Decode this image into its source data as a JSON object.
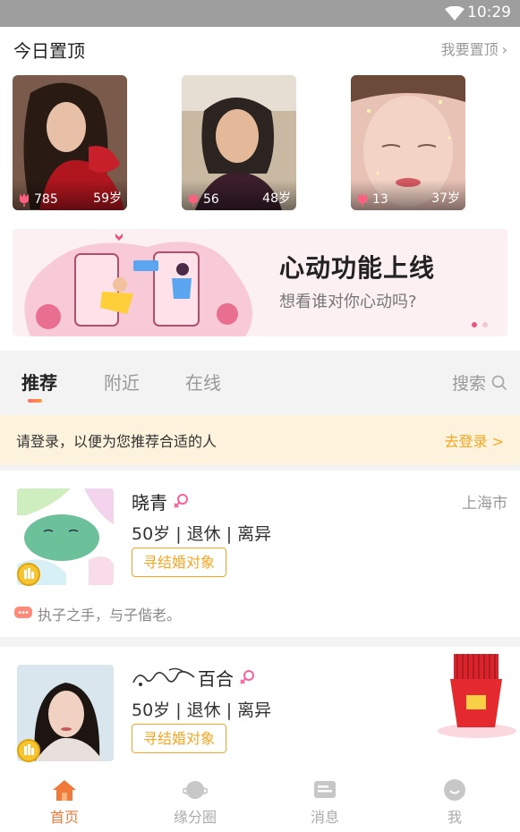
{
  "status_bar": {
    "time": "10:29"
  },
  "top_section": {
    "title": "今日置顶",
    "action": "我要置顶",
    "pinned_users": [
      {
        "likes": "785",
        "age": "59岁"
      },
      {
        "likes": "56",
        "age": "48岁"
      },
      {
        "likes": "13",
        "age": "37岁"
      }
    ]
  },
  "banner": {
    "title": "心动功能上线",
    "subtitle": "想看谁对你心动吗?"
  },
  "tabs": [
    "推荐",
    "附近",
    "在线"
  ],
  "search_label": "搜索",
  "login_bar": {
    "message": "请登录，以便为您推荐合适的人",
    "action": "去登录",
    "action_arrow": ">"
  },
  "users": [
    {
      "name": "晓青",
      "city": "上海市",
      "info": "50岁 | 退休 | 离异",
      "tag": "寻结婚对象",
      "quote": "执子之手，与子偕老。"
    },
    {
      "name": "百合",
      "info": "50岁 | 退休 | 离异",
      "tag": "寻结婚对象"
    }
  ],
  "bottom_nav": [
    "首页",
    "缘分圈",
    "消息",
    "我"
  ],
  "colors": {
    "accent": "#f5a623",
    "pink": "#e8557a",
    "nav_active": "#f07a3c"
  }
}
